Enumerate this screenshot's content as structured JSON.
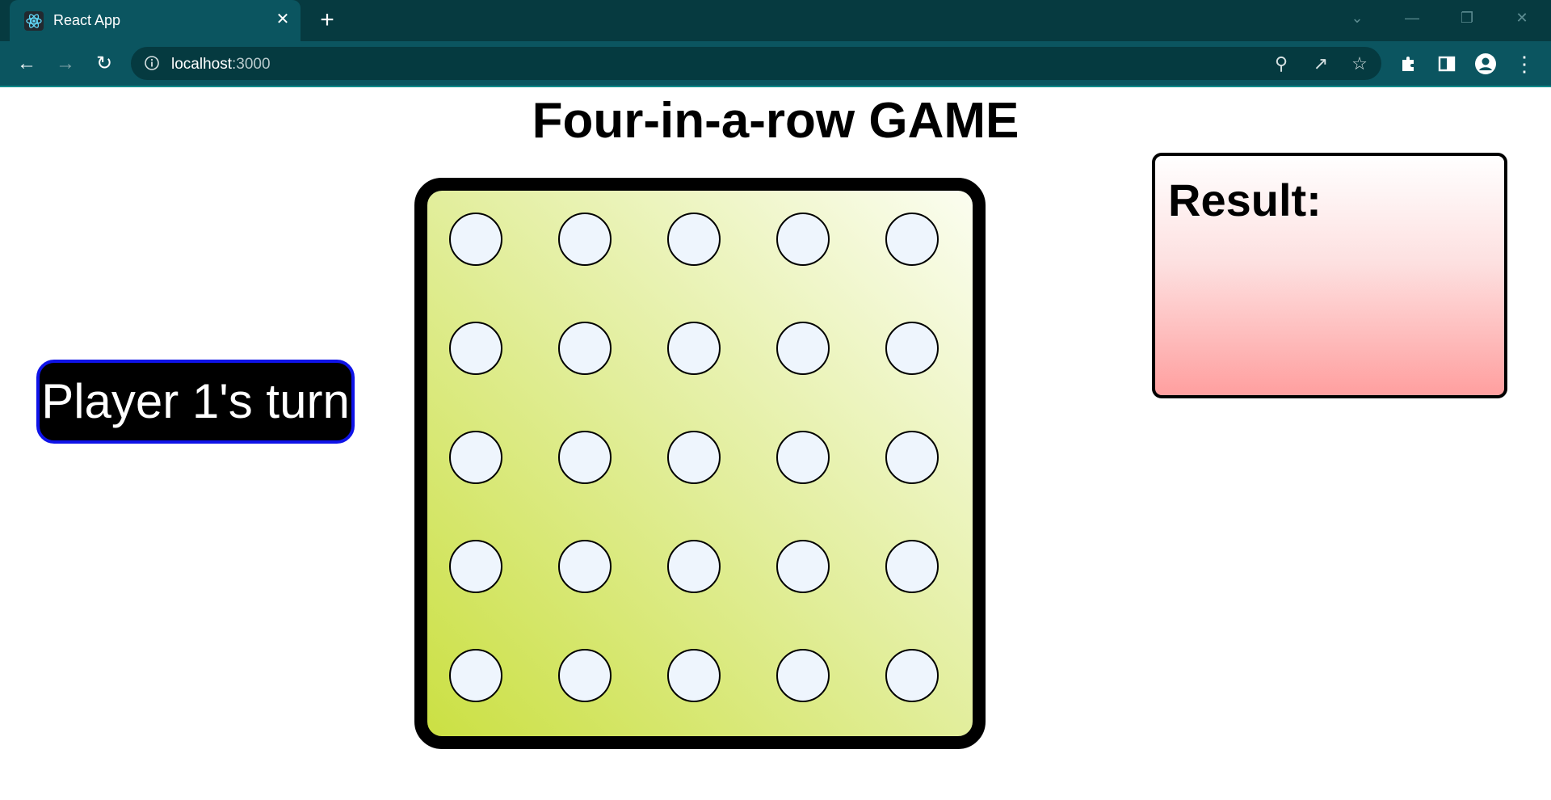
{
  "browser": {
    "tab_title": "React App",
    "tab_close": "✕",
    "new_tab": "+",
    "url_host": "localhost",
    "url_port": ":3000",
    "icons": {
      "back": "arrow-left-icon",
      "forward": "arrow-right-icon",
      "reload": "reload-icon",
      "info": "info-icon",
      "zoom": "zoom-out-icon",
      "share": "share-icon",
      "bookmark": "star-icon",
      "extensions": "puzzle-icon",
      "sidepanel": "side-panel-icon",
      "profile": "profile-icon",
      "menu": "kebab-menu-icon"
    }
  },
  "game": {
    "title": "Four-in-a-row GAME",
    "turn_text": "Player 1's turn",
    "result_label": "Result:",
    "rows": 5,
    "cols": 5,
    "colors": {
      "board_border": "#000000",
      "cell_fill": "#eef5fd",
      "turn_border": "#0f13e8",
      "result_bottom": "#ff9f9f"
    }
  }
}
